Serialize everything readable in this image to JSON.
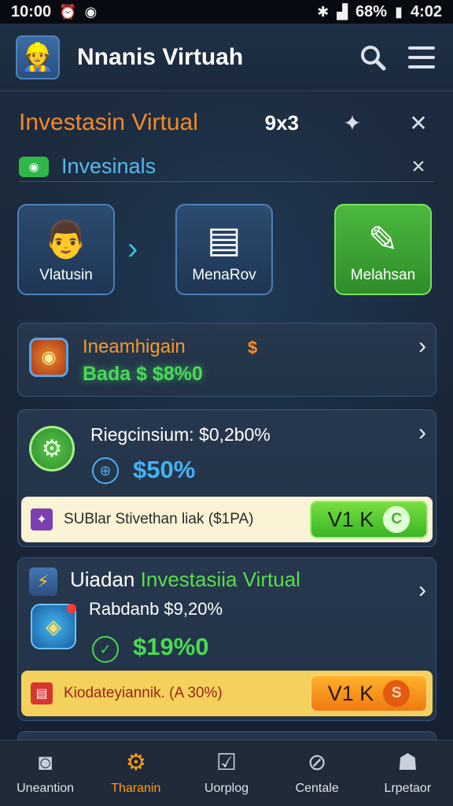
{
  "status_bar": {
    "time": "10:00",
    "battery": "68%",
    "clock_right": "4:02",
    "icons": [
      "alarm-icon",
      "sync-icon",
      "bluetooth-icon",
      "signal-icon",
      "battery-icon"
    ]
  },
  "app_bar": {
    "title": "Nnanis Virtuah",
    "avatar_icon": "avatar-icon",
    "actions": [
      "search-icon",
      "menu-icon"
    ]
  },
  "header": {
    "title": "Investasin Virtual",
    "grid": "9x3",
    "icons": [
      "pin-icon",
      "close-icon"
    ]
  },
  "sub_header": {
    "title": "Invesinals",
    "icons": [
      "badge-icon",
      "close-icon"
    ]
  },
  "tiles": [
    {
      "label": "Vlatusin",
      "icon": "person-icon"
    },
    {
      "label": "MenaRov",
      "icon": "document-icon"
    },
    {
      "label": "Melahsan",
      "icon": "tools-icon"
    }
  ],
  "cards": [
    {
      "title": "Ineamhigain",
      "extra": "$",
      "value": "Bada $ $8%0"
    },
    {
      "title": "Riegcinsium: $0,2b0%",
      "rate": "$50%",
      "offer": {
        "text": "SUBlar Stivethan liak ($1PA)",
        "button": "V1 K",
        "button_icon": "C"
      }
    },
    {
      "title": "Uiadan",
      "title_highlight": "Investasiia Virtual",
      "subtitle": "Rabdanb $9,20%",
      "rate": "$19%0",
      "offer": {
        "text": "Kiodateyiannik. (A 30%)",
        "button": "V1 K",
        "button_icon": "S"
      }
    }
  ],
  "bottom_nav": [
    {
      "label": "Uneantion",
      "icon": "camera-icon",
      "active": false
    },
    {
      "label": "Tharanin",
      "icon": "gear-icon",
      "active": true
    },
    {
      "label": "Uorplog",
      "icon": "check-icon",
      "active": false
    },
    {
      "label": "Centale",
      "icon": "compass-icon",
      "active": false
    },
    {
      "label": "Lrpetaor",
      "icon": "user-icon",
      "active": false
    }
  ],
  "colors": {
    "accent_orange": "#ff9d18",
    "accent_green": "#48db58",
    "accent_blue": "#42b3f6"
  }
}
